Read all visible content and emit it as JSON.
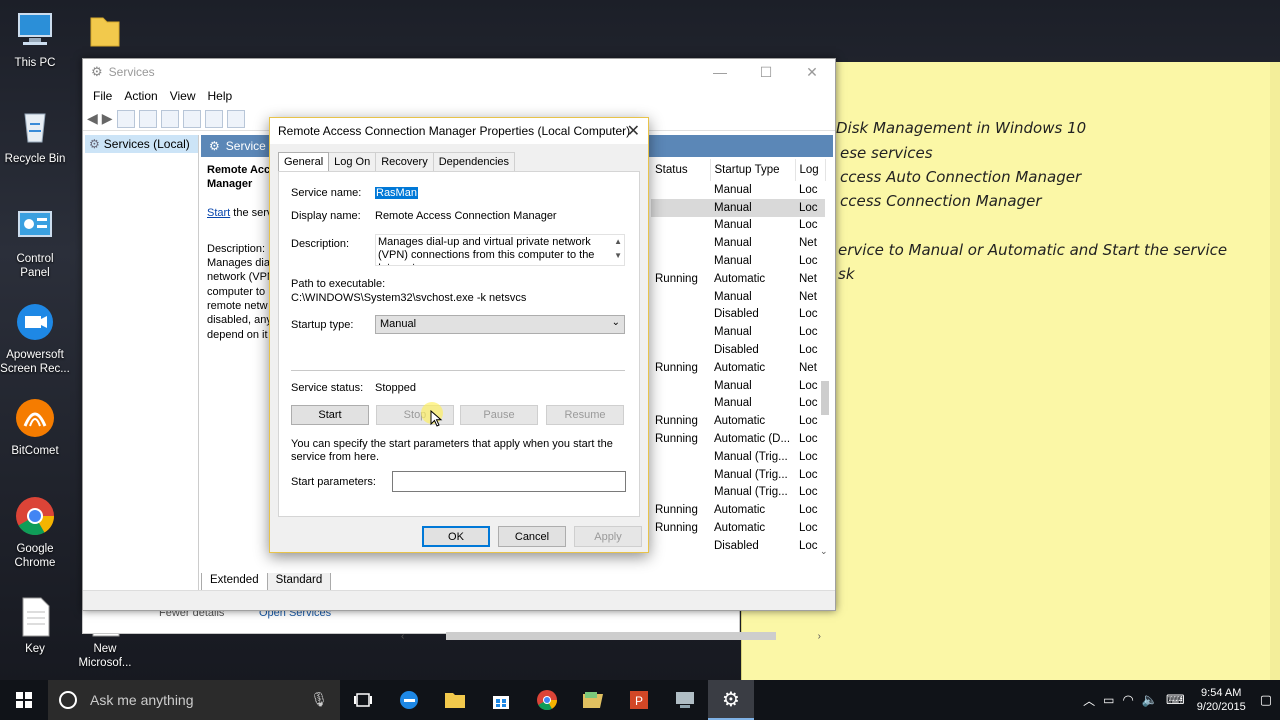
{
  "desktop": {
    "icons": [
      {
        "label": "This PC",
        "icon": "computer-icon"
      },
      {
        "label": "Recycle Bin",
        "icon": "recycle-bin-icon"
      },
      {
        "label": "Control\nPanel",
        "icon": "control-panel-icon"
      },
      {
        "label": "Apowersoft\nScreen Rec...",
        "icon": "screen-recorder-icon"
      },
      {
        "label": "BitComet",
        "icon": "bitcomet-icon"
      },
      {
        "label": "Google\nChrome",
        "icon": "chrome-icon"
      },
      {
        "label": "Key",
        "icon": "document-icon"
      },
      {
        "label": "New\nMicrosof...",
        "icon": "document-icon"
      }
    ]
  },
  "sticky_note": {
    "lines": [
      "Disk Management in Windows 10",
      "ese services",
      "ccess Auto Connection Manager",
      "ccess Connection Manager",
      "ervice to Manual or Automatic and Start the service",
      "sk"
    ]
  },
  "services_window": {
    "title": "Services",
    "menu": [
      "File",
      "Action",
      "View",
      "Help"
    ],
    "tree_node": "Services (Local)",
    "pane_header": "Service",
    "detail": {
      "name_part1": "Remote Acc",
      "name_part2": "Manager",
      "start_link": "Start",
      "start_rest": " the serv",
      "description_label": "Description:",
      "description_lines": [
        "Manages dia",
        "network (VPN",
        "computer to",
        "remote netw",
        "disabled, any",
        "depend on it"
      ]
    },
    "columns": [
      "Status",
      "Startup Type",
      "Log"
    ],
    "rows": [
      {
        "status": "",
        "startup": "Manual",
        "log": "Loc"
      },
      {
        "status": "",
        "startup": "Manual",
        "log": "Loc"
      },
      {
        "status": "",
        "startup": "Manual",
        "log": "Loc"
      },
      {
        "status": "",
        "startup": "Manual",
        "log": "Net"
      },
      {
        "status": "",
        "startup": "Manual",
        "log": "Loc"
      },
      {
        "status": "Running",
        "startup": "Automatic",
        "log": "Net"
      },
      {
        "status": "",
        "startup": "Manual",
        "log": "Net"
      },
      {
        "status": "",
        "startup": "Disabled",
        "log": "Loc"
      },
      {
        "status": "",
        "startup": "Manual",
        "log": "Loc"
      },
      {
        "status": "",
        "startup": "Disabled",
        "log": "Loc"
      },
      {
        "status": "Running",
        "startup": "Automatic",
        "log": "Net"
      },
      {
        "status": "",
        "startup": "Manual",
        "log": "Loc"
      },
      {
        "status": "",
        "startup": "Manual",
        "log": "Loc"
      },
      {
        "status": "Running",
        "startup": "Automatic",
        "log": "Loc"
      },
      {
        "status": "Running",
        "startup": "Automatic (D...",
        "log": "Loc"
      },
      {
        "status": "",
        "startup": "Manual (Trig...",
        "log": "Loc"
      },
      {
        "status": "",
        "startup": "Manual (Trig...",
        "log": "Loc"
      },
      {
        "status": "",
        "startup": "Manual (Trig...",
        "log": "Loc"
      },
      {
        "status": "Running",
        "startup": "Automatic",
        "log": "Loc"
      },
      {
        "status": "Running",
        "startup": "Automatic",
        "log": "Loc"
      },
      {
        "status": "",
        "startup": "Disabled",
        "log": "Loc"
      }
    ],
    "selected_row_index": 1,
    "tabs": [
      "Extended",
      "Standard"
    ]
  },
  "explorer_strip": {
    "fewer_details": "Fewer details",
    "open_services": "Open Services"
  },
  "dialog": {
    "title": "Remote Access Connection Manager Properties (Local Computer)",
    "tabs": [
      "General",
      "Log On",
      "Recovery",
      "Dependencies"
    ],
    "service_name_label": "Service name:",
    "service_name": "RasMan",
    "display_name_label": "Display name:",
    "display_name": "Remote Access Connection Manager",
    "description_label": "Description:",
    "description": "Manages dial-up and virtual private network (VPN) connections from this computer to the Internet or",
    "path_label": "Path to executable:",
    "path": "C:\\WINDOWS\\System32\\svchost.exe -k netsvcs",
    "startup_type_label": "Startup type:",
    "startup_type": "Manual",
    "status_label": "Service status:",
    "status": "Stopped",
    "buttons": {
      "start": "Start",
      "stop": "Stop",
      "pause": "Pause",
      "resume": "Resume"
    },
    "info": "You can specify the start parameters that apply when you start the service from here.",
    "start_params_label": "Start parameters:",
    "start_params_value": "",
    "ok": "OK",
    "cancel": "Cancel",
    "apply": "Apply"
  },
  "taskbar": {
    "search_placeholder": "Ask me anything",
    "time": "9:54 AM",
    "date": "9/20/2015"
  }
}
